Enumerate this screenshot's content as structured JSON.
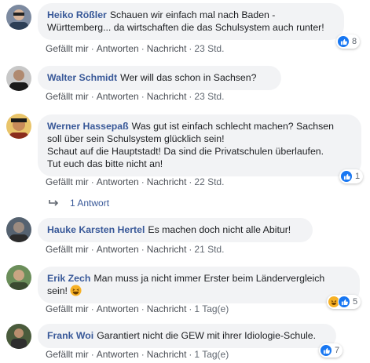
{
  "comments": [
    {
      "author": "Heiko Rößler",
      "text_line1": "Schauen wir einfach mal nach Baden -",
      "text_line2": "Württemberg... da wirtschaften die das Schulsystem auch runter!",
      "reaction_count": "8",
      "actions": [
        "Gefällt mir",
        "Antworten",
        "Nachricht"
      ],
      "time": "23 Std."
    },
    {
      "author": "Walter Schmidt",
      "text_line1": "Wer will das schon in Sachsen?",
      "actions": [
        "Gefällt mir",
        "Antworten",
        "Nachricht"
      ],
      "time": "23 Std."
    },
    {
      "author": "Werner Hassepaß",
      "text_line1": "Was gut ist einfach schlecht machen? Sachsen",
      "text_line2": "soll über sein Schulsystem glücklich sein!",
      "text_line3": "Schaut auf die Hauptstadt! Da sind die Privatschulen überlaufen.",
      "text_line4": "Tut euch das bitte nicht an!",
      "reaction_count": "1",
      "actions": [
        "Gefällt mir",
        "Antworten",
        "Nachricht"
      ],
      "time": "22 Std.",
      "replies_label": "1 Antwort"
    },
    {
      "author": "Hauke Karsten Hertel",
      "text_line1": "Es machen doch nicht alle Abitur!",
      "actions": [
        "Gefällt mir",
        "Antworten",
        "Nachricht"
      ],
      "time": "21 Std."
    },
    {
      "author": "Erik Zech",
      "text_line1": "Man muss ja nicht immer Erster beim Ländervergleich",
      "text_line2": "sein!",
      "emoji": "laughing-emoji",
      "reaction_count": "5",
      "actions": [
        "Gefällt mir",
        "Antworten",
        "Nachricht"
      ],
      "time": "1 Tag(e)"
    },
    {
      "author": "Frank Woi",
      "text_line1": "Garantiert nicht die GEW mit ihrer Idiologie-Schule.",
      "reaction_count": "7",
      "actions": [
        "Gefällt mir",
        "Antworten",
        "Nachricht"
      ],
      "time": "1 Tag(e)"
    }
  ],
  "colors": {
    "author": "#385898",
    "bubble": "#f2f3f5",
    "meta": "#606770",
    "like": "#1877f2",
    "haha": "#f7b125"
  }
}
